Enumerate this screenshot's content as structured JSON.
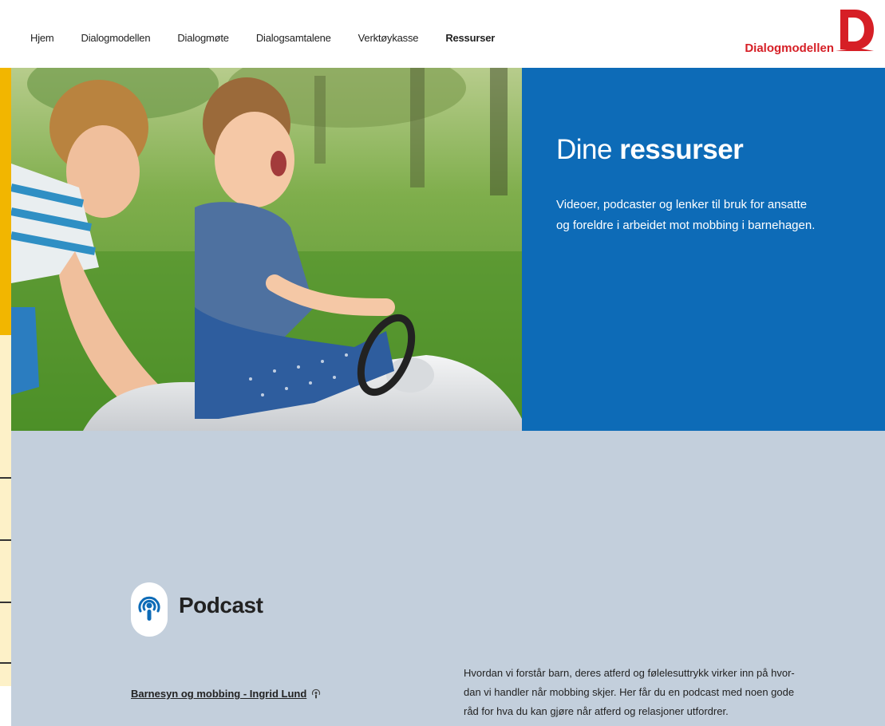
{
  "nav": {
    "items": [
      {
        "label": "Hjem"
      },
      {
        "label": "Dialogmodellen"
      },
      {
        "label": "Dialogmøte"
      },
      {
        "label": "Dialogsamtalene"
      },
      {
        "label": "Verktøykasse"
      },
      {
        "label": "Ressurser"
      }
    ],
    "active_index": 5
  },
  "logo": {
    "text": "Dialogmodellen",
    "icon": "dialogmodellen-logo-icon"
  },
  "hero": {
    "title_light": "Dine",
    "title_bold": "ressurser",
    "lead": "Videoer, podcaster og lenker til bruk for ansatte og foreldre i arbeidet mot mobbing i barnehagen.",
    "image_icon": "children-playing-photo"
  },
  "podcast": {
    "heading": "Podcast",
    "icon": "podcast-icon",
    "link_label": "Barnesyn og mobbing - Ingrid Lund",
    "description": "Hvordan vi forstår barn, deres atferd og følelesuttrykk virker inn på hvor-dan vi handler når mobbing skjer. Her får du en podcast med noen gode råd for hva du kan gjøre når atferd og relasjoner utfordrer."
  },
  "colors": {
    "accent_blue": "#0d6bb7",
    "brand_red": "#d61f26",
    "strip_yellow": "#f2b600",
    "section_bg": "#c3cfdc"
  }
}
